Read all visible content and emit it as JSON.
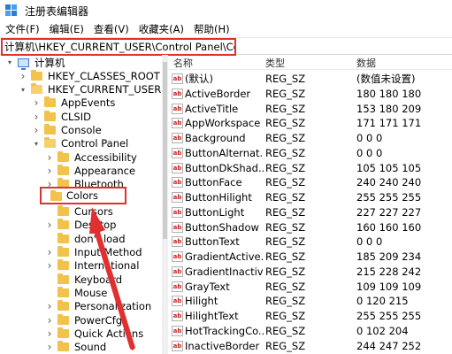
{
  "window": {
    "title": "注册表编辑器"
  },
  "menu": [
    {
      "name": "menu-file",
      "label": "文件(F)"
    },
    {
      "name": "menu-edit",
      "label": "编辑(E)"
    },
    {
      "name": "menu-view",
      "label": "查看(V)"
    },
    {
      "name": "menu-favorites",
      "label": "收藏夹(A)"
    },
    {
      "name": "menu-help",
      "label": "帮助(H)"
    }
  ],
  "address": {
    "path": "计算机\\HKEY_CURRENT_USER\\Control Panel\\Colors"
  },
  "tree": [
    {
      "label": "计算机",
      "level": 0,
      "expanded": true,
      "icon": "computer-icon"
    },
    {
      "label": "HKEY_CLASSES_ROOT",
      "level": 1,
      "expanded": false,
      "icon": "folder-icon"
    },
    {
      "label": "HKEY_CURRENT_USER",
      "level": 1,
      "expanded": true,
      "icon": "folder-icon"
    },
    {
      "label": "AppEvents",
      "level": 2,
      "expanded": false,
      "icon": "folder-icon"
    },
    {
      "label": "CLSID",
      "level": 2,
      "expanded": false,
      "icon": "folder-icon"
    },
    {
      "label": "Console",
      "level": 2,
      "expanded": false,
      "icon": "folder-icon"
    },
    {
      "label": "Control Panel",
      "level": 2,
      "expanded": true,
      "icon": "folder-icon"
    },
    {
      "label": "Accessibility",
      "level": 3,
      "expanded": false,
      "icon": "folder-icon"
    },
    {
      "label": "Appearance",
      "level": 3,
      "expanded": false,
      "icon": "folder-icon"
    },
    {
      "label": "Bluetooth",
      "level": 3,
      "expanded": false,
      "icon": "folder-icon"
    },
    {
      "label": "Colors",
      "level": 3,
      "expanded": null,
      "icon": "folder-icon",
      "selected": true
    },
    {
      "label": "Cursors",
      "level": 3,
      "expanded": null,
      "icon": "folder-icon"
    },
    {
      "label": "Desktop",
      "level": 3,
      "expanded": false,
      "icon": "folder-icon"
    },
    {
      "label": "don't load",
      "level": 3,
      "expanded": null,
      "icon": "folder-icon"
    },
    {
      "label": "Input Method",
      "level": 3,
      "expanded": false,
      "icon": "folder-icon"
    },
    {
      "label": "International",
      "level": 3,
      "expanded": false,
      "icon": "folder-icon"
    },
    {
      "label": "Keyboard",
      "level": 3,
      "expanded": null,
      "icon": "folder-icon"
    },
    {
      "label": "Mouse",
      "level": 3,
      "expanded": null,
      "icon": "folder-icon"
    },
    {
      "label": "Personalization",
      "level": 3,
      "expanded": false,
      "icon": "folder-icon"
    },
    {
      "label": "PowerCfg",
      "level": 3,
      "expanded": false,
      "icon": "folder-icon"
    },
    {
      "label": "Quick Actions",
      "level": 3,
      "expanded": false,
      "icon": "folder-icon"
    },
    {
      "label": "Sound",
      "level": 3,
      "expanded": false,
      "icon": "folder-icon"
    }
  ],
  "list": {
    "columns": {
      "name": "名称",
      "type": "类型",
      "data": "数据"
    },
    "icon_text": "ab",
    "rows": [
      {
        "name": "(默认)",
        "type": "REG_SZ",
        "data": "(数值未设置)"
      },
      {
        "name": "ActiveBorder",
        "type": "REG_SZ",
        "data": "180 180 180"
      },
      {
        "name": "ActiveTitle",
        "type": "REG_SZ",
        "data": "153 180 209"
      },
      {
        "name": "AppWorkspace",
        "type": "REG_SZ",
        "data": "171 171 171"
      },
      {
        "name": "Background",
        "type": "REG_SZ",
        "data": "0 0 0"
      },
      {
        "name": "ButtonAlternat...",
        "type": "REG_SZ",
        "data": "0 0 0"
      },
      {
        "name": "ButtonDkShad...",
        "type": "REG_SZ",
        "data": "105 105 105"
      },
      {
        "name": "ButtonFace",
        "type": "REG_SZ",
        "data": "240 240 240"
      },
      {
        "name": "ButtonHilight",
        "type": "REG_SZ",
        "data": "255 255 255"
      },
      {
        "name": "ButtonLight",
        "type": "REG_SZ",
        "data": "227 227 227"
      },
      {
        "name": "ButtonShadow",
        "type": "REG_SZ",
        "data": "160 160 160"
      },
      {
        "name": "ButtonText",
        "type": "REG_SZ",
        "data": "0 0 0"
      },
      {
        "name": "GradientActive...",
        "type": "REG_SZ",
        "data": "185 209 234"
      },
      {
        "name": "GradientInactiv...",
        "type": "REG_SZ",
        "data": "215 228 242"
      },
      {
        "name": "GrayText",
        "type": "REG_SZ",
        "data": "109 109 109"
      },
      {
        "name": "Hilight",
        "type": "REG_SZ",
        "data": "0 120 215"
      },
      {
        "name": "HilightText",
        "type": "REG_SZ",
        "data": "255 255 255"
      },
      {
        "name": "HotTrackingCo...",
        "type": "REG_SZ",
        "data": "0 102 204"
      },
      {
        "name": "InactiveBorder",
        "type": "REG_SZ",
        "data": "244 247 252"
      }
    ]
  },
  "colors": {
    "annotation_red": "#e03030",
    "folder": "#f1c24c"
  }
}
